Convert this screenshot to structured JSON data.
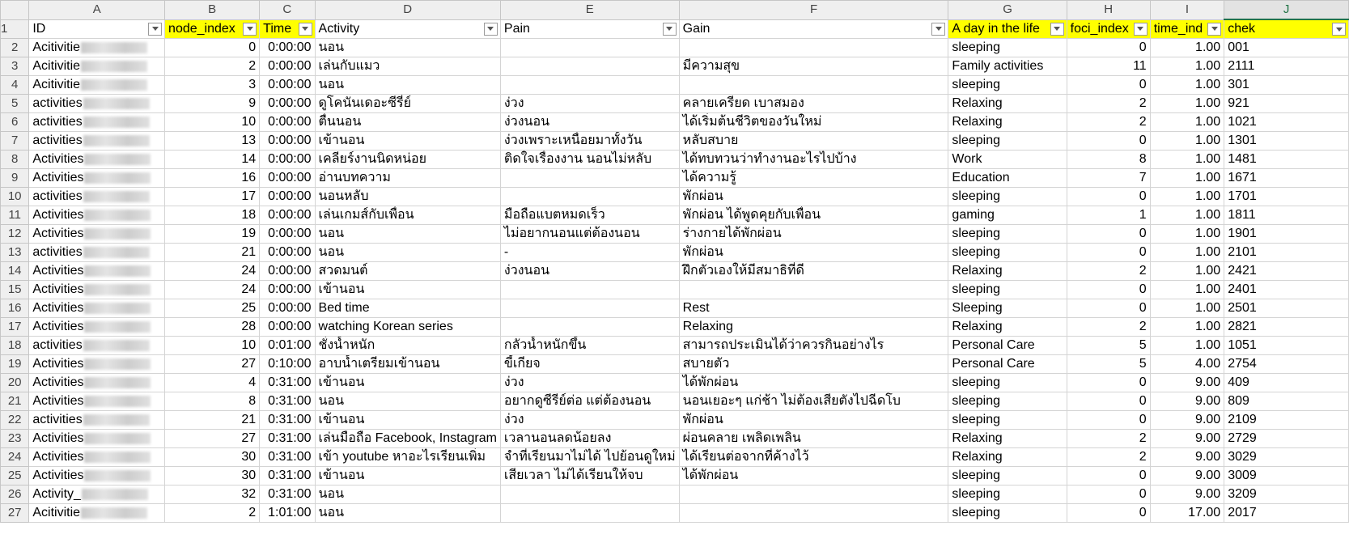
{
  "columns": [
    "A",
    "B",
    "C",
    "D",
    "E",
    "F",
    "G",
    "H",
    "I",
    "J"
  ],
  "selected_column": "J",
  "header_row_number": "1",
  "headers": [
    "ID",
    "node_index",
    "Time",
    "Activity",
    "Pain",
    "Gain",
    "A day in the life",
    "foci_index",
    "time_ind",
    "chek"
  ],
  "rows": [
    {
      "n": "2",
      "id": "Acitivitie",
      "node": "0",
      "time": "0:00:00",
      "activity": "นอน",
      "pain": "",
      "gain": "",
      "day": "sleeping",
      "foci": "0",
      "ti": "1.00",
      "chek": "001"
    },
    {
      "n": "3",
      "id": "Acitivitie",
      "node": "2",
      "time": "0:00:00",
      "activity": "เล่นกับแมว",
      "pain": "",
      "gain": "มีความสุข",
      "day": "Family activities",
      "foci": "11",
      "ti": "1.00",
      "chek": "2111"
    },
    {
      "n": "4",
      "id": "Acitivitie",
      "node": "3",
      "time": "0:00:00",
      "activity": "นอน",
      "pain": "",
      "gain": "",
      "day": "sleeping",
      "foci": "0",
      "ti": "1.00",
      "chek": "301"
    },
    {
      "n": "5",
      "id": "activities",
      "node": "9",
      "time": "0:00:00",
      "activity": "ดูโคนันเดอะซีรี่ย์",
      "pain": "ง่วง",
      "gain": "คลายเครียด เบาสมอง",
      "day": "Relaxing",
      "foci": "2",
      "ti": "1.00",
      "chek": "921"
    },
    {
      "n": "6",
      "id": "activities",
      "node": "10",
      "time": "0:00:00",
      "activity": "ตื่นนอน",
      "pain": "ง่วงนอน",
      "gain": "ได้เริ่มต้นชีวิตของวันใหม่",
      "day": "Relaxing",
      "foci": "2",
      "ti": "1.00",
      "chek": "1021"
    },
    {
      "n": "7",
      "id": "activities",
      "node": "13",
      "time": "0:00:00",
      "activity": "เข้านอน",
      "pain": "ง่วงเพราะเหนื่อยมาทั้งวัน",
      "gain": "หลับสบาย",
      "day": "sleeping",
      "foci": "0",
      "ti": "1.00",
      "chek": "1301"
    },
    {
      "n": "8",
      "id": "Activities",
      "node": "14",
      "time": "0:00:00",
      "activity": "เคลียร์งานนิดหน่อย",
      "pain": "ติดใจเรื่องงาน นอนไม่หลับ",
      "gain": "ได้ทบทวนว่าทำงานอะไรไปบ้าง",
      "day": "Work",
      "foci": "8",
      "ti": "1.00",
      "chek": "1481"
    },
    {
      "n": "9",
      "id": "Activities",
      "node": "16",
      "time": "0:00:00",
      "activity": "อ่านบทความ",
      "pain": "",
      "gain": "ได้ความรู้",
      "day": "Education",
      "foci": "7",
      "ti": "1.00",
      "chek": "1671"
    },
    {
      "n": "10",
      "id": "activities",
      "node": "17",
      "time": "0:00:00",
      "activity": "นอนหลับ",
      "pain": "",
      "gain": "พักผ่อน",
      "day": "sleeping",
      "foci": "0",
      "ti": "1.00",
      "chek": "1701"
    },
    {
      "n": "11",
      "id": "Activities",
      "node": "18",
      "time": "0:00:00",
      "activity": "เล่นเกมส์กับเพื่อน",
      "pain": "มือถือแบตหมดเร็ว",
      "gain": "พักผ่อน ได้พูดคุยกับเพื่อน",
      "day": "gaming",
      "foci": "1",
      "ti": "1.00",
      "chek": "1811"
    },
    {
      "n": "12",
      "id": "Activities",
      "node": "19",
      "time": "0:00:00",
      "activity": "นอน",
      "pain": "ไม่อยากนอนแต่ต้องนอน",
      "gain": "ร่างกายได้พักผ่อน",
      "day": "sleeping",
      "foci": "0",
      "ti": "1.00",
      "chek": "1901"
    },
    {
      "n": "13",
      "id": "activities",
      "node": "21",
      "time": "0:00:00",
      "activity": "นอน",
      "pain": "-",
      "gain": "พักผ่อน",
      "day": "sleeping",
      "foci": "0",
      "ti": "1.00",
      "chek": "2101"
    },
    {
      "n": "14",
      "id": "Activities",
      "node": "24",
      "time": "0:00:00",
      "activity": "สวดมนต์",
      "pain": "ง่วงนอน",
      "gain": "ฝึกตัวเองให้มีสมาธิที่ดี",
      "day": "Relaxing",
      "foci": "2",
      "ti": "1.00",
      "chek": "2421"
    },
    {
      "n": "15",
      "id": "Activities",
      "node": "24",
      "time": "0:00:00",
      "activity": "เข้านอน",
      "pain": "",
      "gain": "",
      "day": "sleeping",
      "foci": "0",
      "ti": "1.00",
      "chek": "2401"
    },
    {
      "n": "16",
      "id": "Activities",
      "node": "25",
      "time": "0:00:00",
      "activity": "Bed time",
      "pain": "",
      "gain": "Rest",
      "day": "Sleeping",
      "foci": "0",
      "ti": "1.00",
      "chek": "2501"
    },
    {
      "n": "17",
      "id": "Activities",
      "node": "28",
      "time": "0:00:00",
      "activity": "watching Korean series",
      "pain": "",
      "gain": "Relaxing",
      "day": "Relaxing",
      "foci": "2",
      "ti": "1.00",
      "chek": "2821"
    },
    {
      "n": "18",
      "id": "activities",
      "node": "10",
      "time": "0:01:00",
      "activity": "ชั่งน้ำหนัก",
      "pain": "กลัวน้ำหนักขึ้น",
      "gain": "สามารถประเมินได้ว่าควรกินอย่างไร",
      "day": "Personal Care",
      "foci": "5",
      "ti": "1.00",
      "chek": "1051"
    },
    {
      "n": "19",
      "id": "Activities",
      "node": "27",
      "time": "0:10:00",
      "activity": "อาบน้ำเตรียมเข้านอน",
      "pain": "ขี้เกียจ",
      "gain": "สบายตัว",
      "day": "Personal Care",
      "foci": "5",
      "ti": "4.00",
      "chek": "2754"
    },
    {
      "n": "20",
      "id": "Activities",
      "node": "4",
      "time": "0:31:00",
      "activity": "เข้านอน",
      "pain": "ง่วง",
      "gain": "ได้พักผ่อน",
      "day": "sleeping",
      "foci": "0",
      "ti": "9.00",
      "chek": "409"
    },
    {
      "n": "21",
      "id": "Activities",
      "node": "8",
      "time": "0:31:00",
      "activity": "นอน",
      "pain": "อยากดูซีรีย์ต่อ แต่ต้องนอน",
      "gain": "นอนเยอะๆ แก่ช้า ไม่ต้องเสียตังไปฉีดโบ",
      "day": "sleeping",
      "foci": "0",
      "ti": "9.00",
      "chek": "809"
    },
    {
      "n": "22",
      "id": "activities",
      "node": "21",
      "time": "0:31:00",
      "activity": "เข้านอน",
      "pain": "ง่วง",
      "gain": "พักผ่อน",
      "day": "sleeping",
      "foci": "0",
      "ti": "9.00",
      "chek": "2109"
    },
    {
      "n": "23",
      "id": "Activities",
      "node": "27",
      "time": "0:31:00",
      "activity": "เล่นมือถือ Facebook, Instagram",
      "pain": "เวลานอนลดน้อยลง",
      "gain": "ผ่อนคลาย เพลิดเพลิน",
      "day": "Relaxing",
      "foci": "2",
      "ti": "9.00",
      "chek": "2729"
    },
    {
      "n": "24",
      "id": "Activities",
      "node": "30",
      "time": "0:31:00",
      "activity": "เข้า youtube หาอะไรเรียนเพิ่ม",
      "pain": "จำที่เรียนมาไม่ได้ ไปย้อนดูใหม่",
      "gain": "ได้เรียนต่อจากที่ค้างไว้",
      "day": "Relaxing",
      "foci": "2",
      "ti": "9.00",
      "chek": "3029"
    },
    {
      "n": "25",
      "id": "Activities",
      "node": "30",
      "time": "0:31:00",
      "activity": "เข้านอน",
      "pain": "เสียเวลา ไม่ได้เรียนให้จบ",
      "gain": "ได้พักผ่อน",
      "day": "sleeping",
      "foci": "0",
      "ti": "9.00",
      "chek": "3009"
    },
    {
      "n": "26",
      "id": "Activity_",
      "node": "32",
      "time": "0:31:00",
      "activity": "นอน",
      "pain": "",
      "gain": "",
      "day": "sleeping",
      "foci": "0",
      "ti": "9.00",
      "chek": "3209"
    },
    {
      "n": "27",
      "id": "Acitivitie",
      "node": "2",
      "time": "1:01:00",
      "activity": "นอน",
      "pain": "",
      "gain": "",
      "day": "sleeping",
      "foci": "0",
      "ti": "17.00",
      "chek": "2017"
    }
  ]
}
